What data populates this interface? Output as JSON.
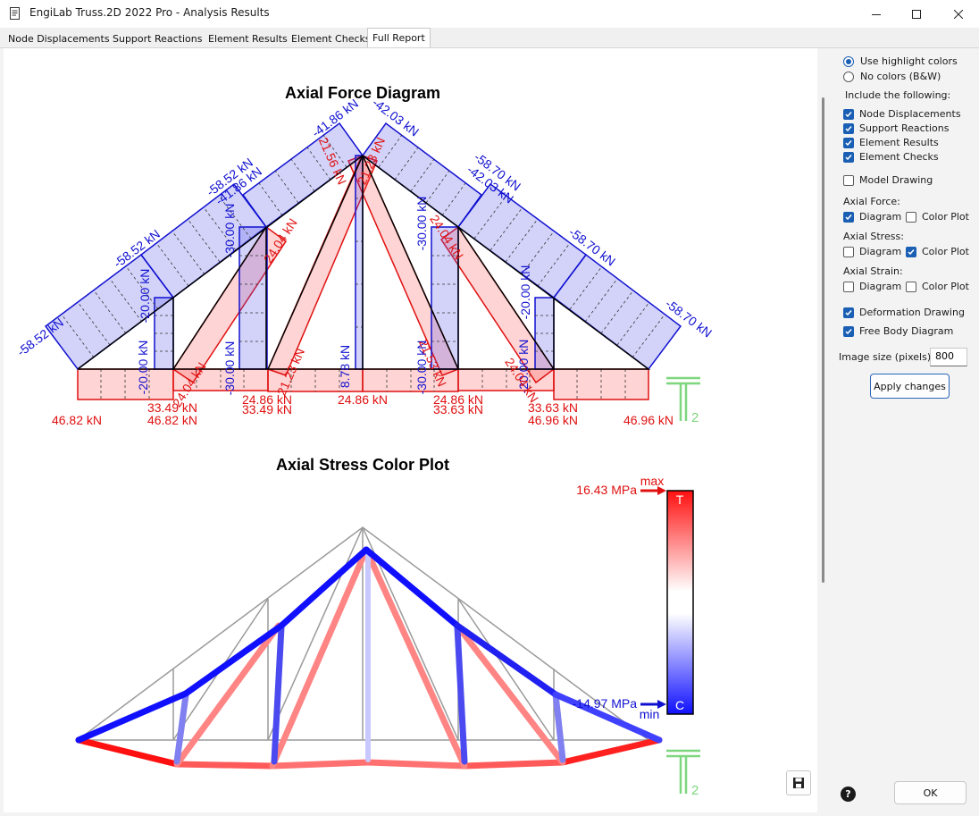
{
  "window": {
    "title": "EngiLab Truss.2D 2022 Pro - Analysis Results"
  },
  "tabs": [
    "Node Displacements",
    "Support Reactions",
    "Element Results",
    "Element Checks",
    "Full Report"
  ],
  "panel": {
    "radio_highlight": "Use highlight colors",
    "radio_bw": "No colors (B&W)",
    "include_label": "Include the following:",
    "cb_node_displacements": "Node Displacements",
    "cb_support_reactions": "Support Reactions",
    "cb_element_results": "Element Results",
    "cb_element_checks": "Element Checks",
    "cb_model_drawing": "Model Drawing",
    "axial_force_label": "Axial Force:",
    "axial_stress_label": "Axial Stress:",
    "axial_strain_label": "Axial Strain:",
    "diagram": "Diagram",
    "color_plot": "Color Plot",
    "cb_deformation": "Deformation Drawing",
    "cb_fbd": "Free Body Diagram",
    "image_size_label": "Image size (pixels):",
    "image_size_value": "800",
    "apply_button": "Apply changes",
    "ok_button": "OK"
  },
  "diagram1": {
    "title": "Axial Force Diagram",
    "unit_symbol": "2",
    "labels": {
      "ll1": "-58.52 kN",
      "ll2": "-58.52 kN",
      "ll3": "-58.52 kN",
      "ll4": "-41.86 kN",
      "ll5": "-41.86 kN",
      "lr1": "-42.03 kN",
      "lr2": "-58.70 kN",
      "lr3": "-42.03 kN",
      "lr4": "-58.70 kN",
      "lr5": "-58.70 kN",
      "v1": "-20.00 kN",
      "v2": "-20.00 kN",
      "v3": "-30.00 kN",
      "v4": "-30.00 kN",
      "vc": "8.78 kN",
      "v5": "-30.00 kN",
      "v6": "-30.00 kN",
      "v7": "-20.00 kN",
      "v8": "-20.00 kN",
      "b1": "46.82 kN",
      "b2": "33.49 kN",
      "b3": "46.82 kN",
      "b4": "24.86 kN",
      "b5": "33.49 kN",
      "b6": "24.86 kN",
      "b7": "24.86 kN",
      "b8": "33.63 kN",
      "b9": "33.63 kN",
      "b10": "46.96 kN",
      "b11": "46.96 kN",
      "d1": "24.04 kN",
      "d2": "24.04 kN",
      "d3": "21.23 kN",
      "d4": "21.56 kN",
      "d5": "21.53 kN",
      "d6": "24.04 kN",
      "d7": "21.23 kN",
      "d8": "24.04 kN"
    }
  },
  "diagram2": {
    "title": "Axial Stress Color Plot",
    "max_label": "max",
    "max_value": "16.43 MPa",
    "min_label": "min",
    "min_value": "-14.97 MPa",
    "tension": "T",
    "compression": "C",
    "unit_symbol": "2"
  },
  "colors": {
    "tension": "#ff3030",
    "compression": "#2020e0",
    "unit_icon": "#7ed67e"
  }
}
